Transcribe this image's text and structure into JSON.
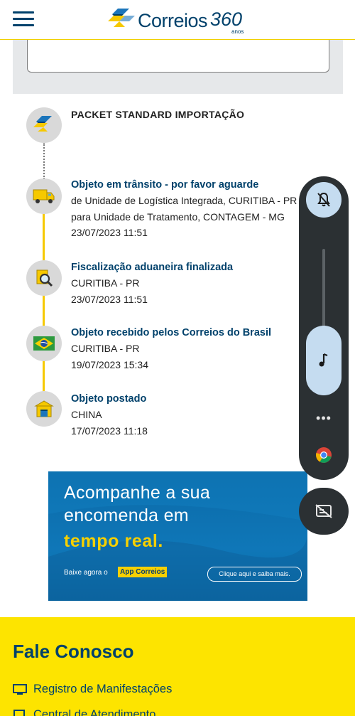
{
  "header": {
    "logo_text": "Correios",
    "logo_360": "360",
    "logo_anos": "anos"
  },
  "tracking": {
    "service_title": "PACKET STANDARD IMPORTAÇÃO",
    "events": [
      {
        "title": "Objeto em trânsito - por favor aguarde",
        "lines": [
          "de Unidade de Logística Integrada, CURITIBA - PR",
          "para Unidade de Tratamento, CONTAGEM - MG",
          "23/07/2023 11:51"
        ],
        "icon": "truck-icon"
      },
      {
        "title": "Fiscalização aduaneira finalizada",
        "lines": [
          "CURITIBA - PR",
          "23/07/2023 11:51"
        ],
        "icon": "magnifier-document-icon"
      },
      {
        "title": "Objeto recebido pelos Correios do Brasil",
        "lines": [
          "CURITIBA - PR",
          "19/07/2023 15:34"
        ],
        "icon": "brazil-flag-icon"
      },
      {
        "title": "Objeto postado",
        "lines": [
          "CHINA",
          "17/07/2023 11:18"
        ],
        "icon": "post-office-icon"
      }
    ]
  },
  "banner": {
    "line1": "Acompanhe a sua",
    "line2": "encomenda em",
    "line3": "tempo real.",
    "download_text": "Baixe agora o",
    "app_name": "App Correios",
    "cta": "Clique aqui e saiba mais."
  },
  "footer": {
    "title": "Fale Conosco",
    "items": [
      {
        "label": "Registro de Manifestações",
        "icon": "monitor-icon"
      },
      {
        "label": "Central de Atendimento",
        "icon": "phone-icon"
      }
    ]
  },
  "overlay": {
    "more_label": "•••",
    "volume_level": 0.38
  },
  "colors": {
    "brand_blue": "#00416b",
    "brand_yellow": "#fde400",
    "timeline_yellow": "#f6c900"
  }
}
